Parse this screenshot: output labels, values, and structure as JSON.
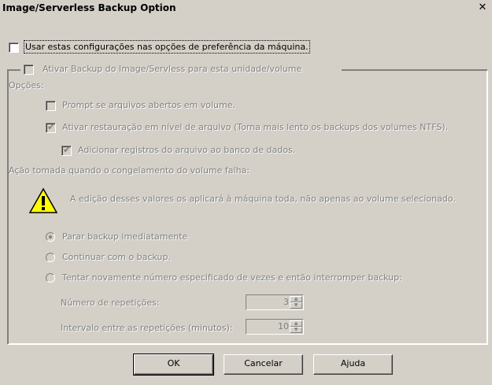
{
  "window": {
    "title": "Image/Serverless Backup Option",
    "close_glyph": "✕"
  },
  "options": {
    "use_machine_prefs": {
      "label": "Usar estas configurações nas opções de preferência da máquina.",
      "checked": false
    },
    "enable_backup": {
      "label": "Ativar Backup do Image/Servless para esta unidade/volume",
      "checked": false
    },
    "section_options": "Opções:",
    "prompt_open_files": {
      "label": "Prompt se arquivos abertos em volume.",
      "checked": false
    },
    "file_level_restore": {
      "label": "Ativar restauração em nível de arquivo (Torna mais lento os backups dos volumes NTFS).",
      "checked": true
    },
    "add_file_records": {
      "label": "Adicionar registros do arquivo ao banco de dados.",
      "checked": true
    },
    "freeze_fail_label": "Ação tomada quando o congelamento do volume falha:",
    "warning_text": "A edição desses valores os aplicará à máquina toda, não apenas ao volume selecionado.",
    "warning_icon": "warning-triangle-icon",
    "radio": {
      "stop_now": {
        "label": "Parar backup imediatamente",
        "selected": true
      },
      "continue": {
        "label": "Continuar com o backup.",
        "selected": false
      },
      "retry": {
        "label": "Tentar novamente número especificado de vezes e então interromper backup:",
        "selected": false
      }
    },
    "retries": {
      "label": "Número de repetições:",
      "value": "3"
    },
    "interval": {
      "label": "Intervalo entre as repetições (minutos):",
      "value": "10"
    }
  },
  "buttons": {
    "ok": "OK",
    "cancel": "Cancelar",
    "help": "Ajuda"
  }
}
